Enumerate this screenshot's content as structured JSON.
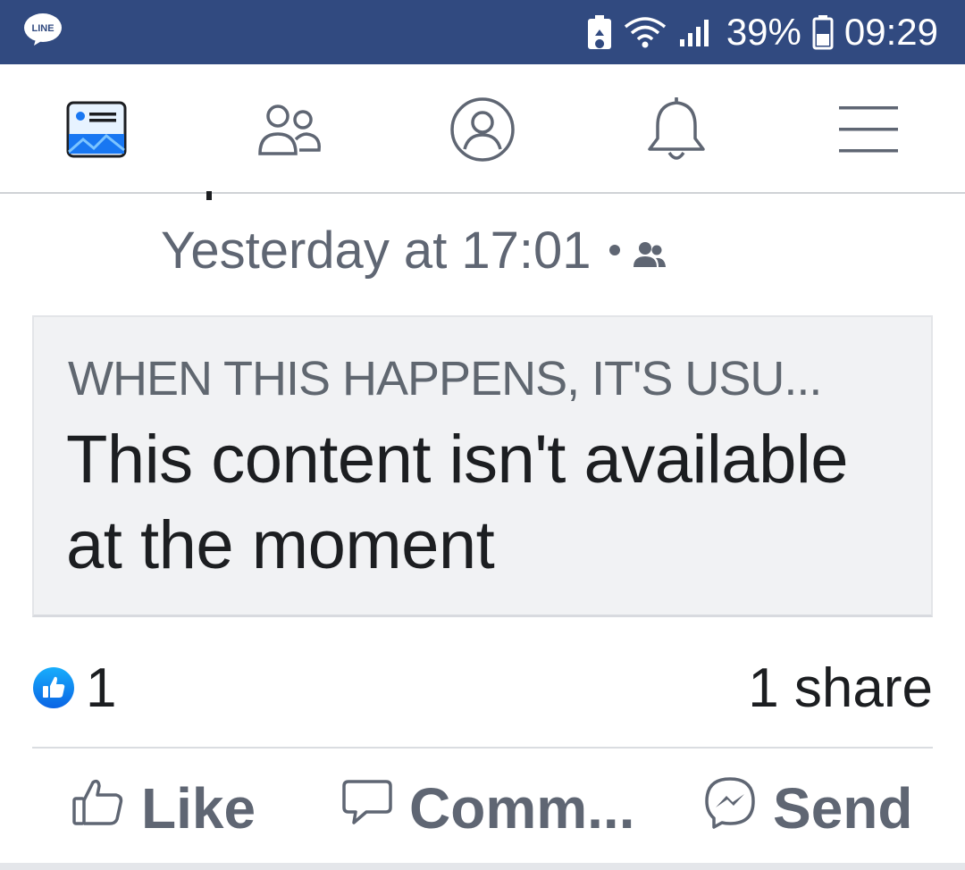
{
  "status_bar": {
    "app_badge": "LINE",
    "battery_percent": "39%",
    "time": "09:29",
    "background": "#314a80"
  },
  "nav": {
    "items": [
      "news-feed-icon",
      "friends-icon",
      "profile-icon",
      "notifications-icon",
      "menu-icon"
    ],
    "active": "news-feed-icon",
    "accent": "#1877f2"
  },
  "post": {
    "timestamp": "Yesterday at 17:01",
    "audience_icon": "friends-audience-icon",
    "attachment": {
      "kicker": "WHEN THIS HAPPENS, IT'S USU...",
      "title": "This content isn't available at the moment"
    },
    "reactions": {
      "like_count": "1",
      "shares": "1 share"
    },
    "actions": {
      "like_label": "Like",
      "comment_label": "Comm...",
      "send_label": "Send"
    }
  }
}
